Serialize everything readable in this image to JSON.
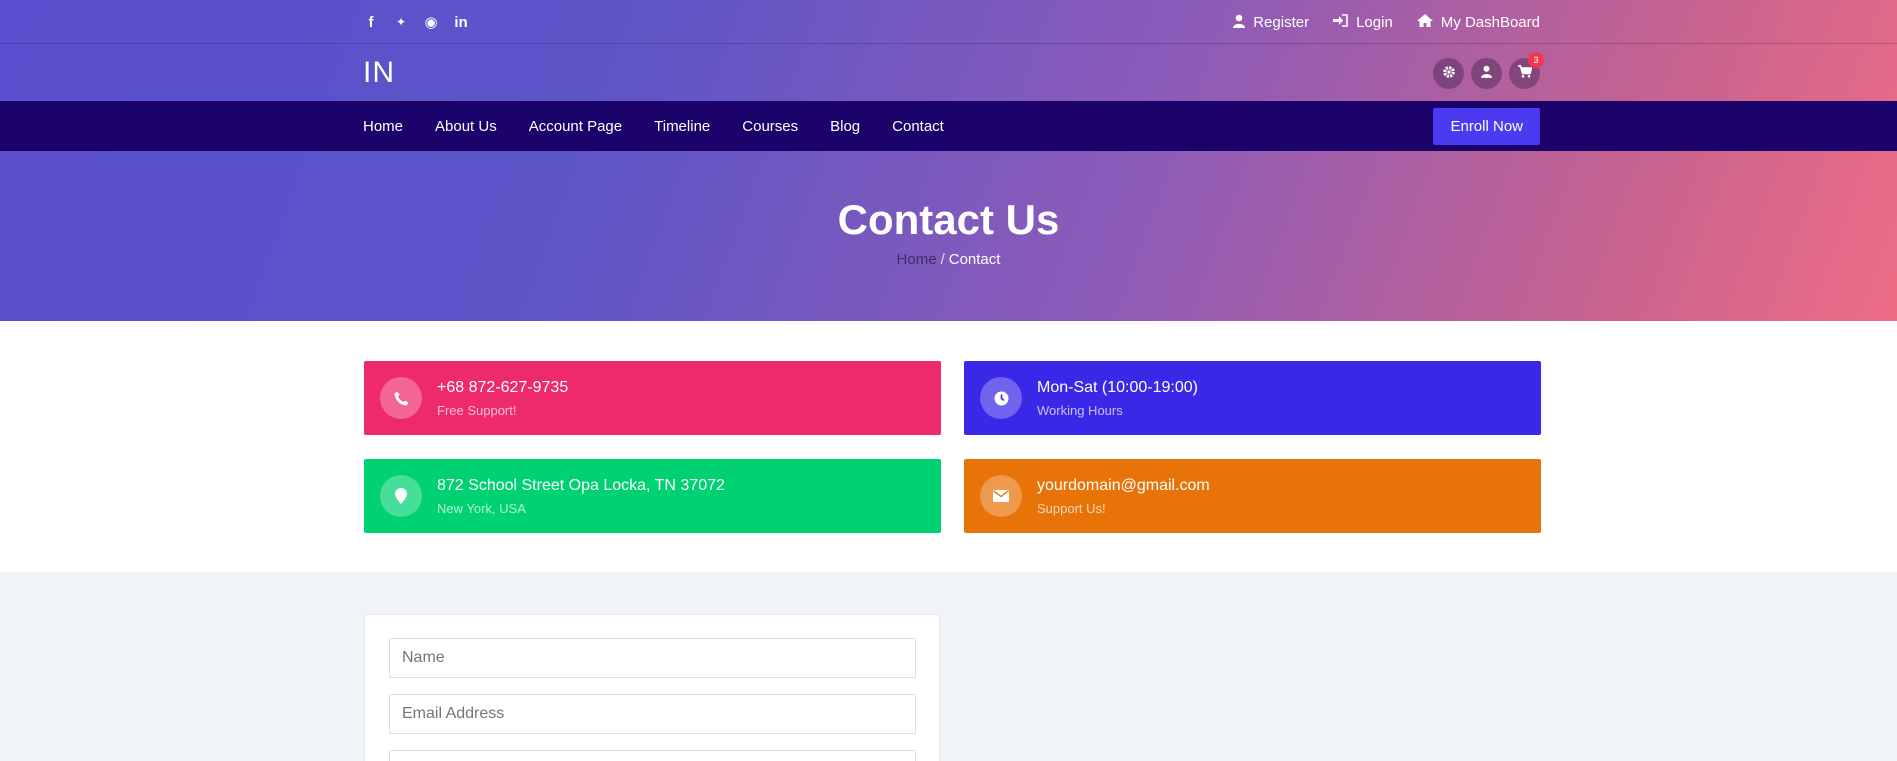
{
  "topbar": {
    "social": [
      {
        "icon": "facebook-icon",
        "glyph": "f"
      },
      {
        "icon": "twitter-icon",
        "glyph": "🐦"
      },
      {
        "icon": "github-icon",
        "glyph": "◉"
      },
      {
        "icon": "linkedin-icon",
        "glyph": "in"
      }
    ],
    "links": [
      {
        "label": "Register",
        "icon": "user-icon"
      },
      {
        "label": "Login",
        "icon": "sign-in-icon"
      },
      {
        "label": "My DashBoard",
        "icon": "home-icon"
      }
    ]
  },
  "brand": {
    "logo": "IN",
    "cart_count": "3"
  },
  "nav": {
    "items": [
      "Home",
      "About Us",
      "Account Page",
      "Timeline",
      "Courses",
      "Blog",
      "Contact"
    ],
    "cta": "Enroll Now"
  },
  "hero": {
    "title": "Contact Us",
    "breadcrumb_home": "Home",
    "breadcrumb_sep": "/",
    "breadcrumb_current": "Contact"
  },
  "info_cards": [
    {
      "title": "+68 872-627-9735",
      "subtitle": "Free Support!",
      "icon": "phone-icon",
      "color": "#ee2a6c"
    },
    {
      "title": "Mon-Sat (10:00-19:00)",
      "subtitle": "Working Hours",
      "icon": "clock-icon",
      "color": "#3a28e8"
    },
    {
      "title": "872 School Street Opa Locka, TN 37072",
      "subtitle": "New York, USA",
      "icon": "map-pin-icon",
      "color": "#00d272"
    },
    {
      "title": "yourdomain@gmail.com",
      "subtitle": "Support Us!",
      "icon": "envelope-icon",
      "color": "#e87409"
    }
  ],
  "form": {
    "name_placeholder": "Name",
    "email_placeholder": "Email Address",
    "third_placeholder": ""
  }
}
